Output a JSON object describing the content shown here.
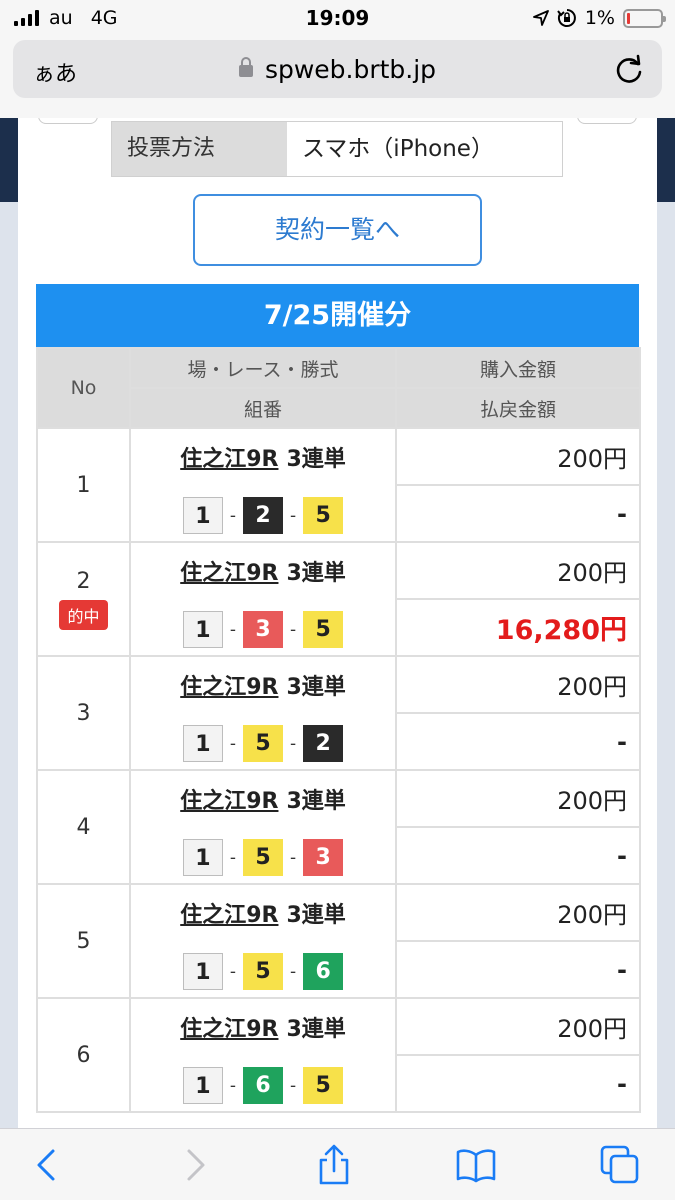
{
  "status": {
    "carrier": "au",
    "network": "4G",
    "time": "19:09",
    "battery": "1%",
    "battery_level": 0.01
  },
  "browser": {
    "text_size": "ぁあ",
    "url": "spweb.brtb.jp"
  },
  "modal": {
    "vote_method_label": "投票方法",
    "vote_method_value": "スマホ（iPhone）",
    "contract_list_button": "契約一覧へ",
    "date_header": "7/25開催分",
    "columns": {
      "no": "No",
      "race": "場・レース・勝式",
      "combo": "組番",
      "purchase": "購入金額",
      "payout": "払戻金額"
    },
    "rows": [
      {
        "no": "1",
        "venue": "住之江9R",
        "bet_type": "3連単",
        "combo": [
          "1",
          "2",
          "5"
        ],
        "purchase": "200円",
        "payout": "-",
        "hit": false
      },
      {
        "no": "2",
        "venue": "住之江9R",
        "bet_type": "3連単",
        "combo": [
          "1",
          "3",
          "5"
        ],
        "purchase": "200円",
        "payout": "16,280円",
        "hit": true,
        "hit_label": "的中"
      },
      {
        "no": "3",
        "venue": "住之江9R",
        "bet_type": "3連単",
        "combo": [
          "1",
          "5",
          "2"
        ],
        "purchase": "200円",
        "payout": "-",
        "hit": false
      },
      {
        "no": "4",
        "venue": "住之江9R",
        "bet_type": "3連単",
        "combo": [
          "1",
          "5",
          "3"
        ],
        "purchase": "200円",
        "payout": "-",
        "hit": false
      },
      {
        "no": "5",
        "venue": "住之江9R",
        "bet_type": "3連単",
        "combo": [
          "1",
          "5",
          "6"
        ],
        "purchase": "200円",
        "payout": "-",
        "hit": false
      },
      {
        "no": "6",
        "venue": "住之江9R",
        "bet_type": "3連単",
        "combo": [
          "1",
          "6",
          "5"
        ],
        "purchase": "200円",
        "payout": "-",
        "hit": false
      }
    ],
    "combo_separator": "-"
  },
  "boat_colors": {
    "1": "#f3f3f3",
    "2": "#2a2a2a",
    "3": "#e85a5a",
    "5": "#f7e14a",
    "6": "#1fa35d"
  },
  "toolbar": {
    "icons": [
      "back-icon",
      "forward-icon",
      "share-icon",
      "bookmarks-icon",
      "tabs-icon"
    ]
  }
}
